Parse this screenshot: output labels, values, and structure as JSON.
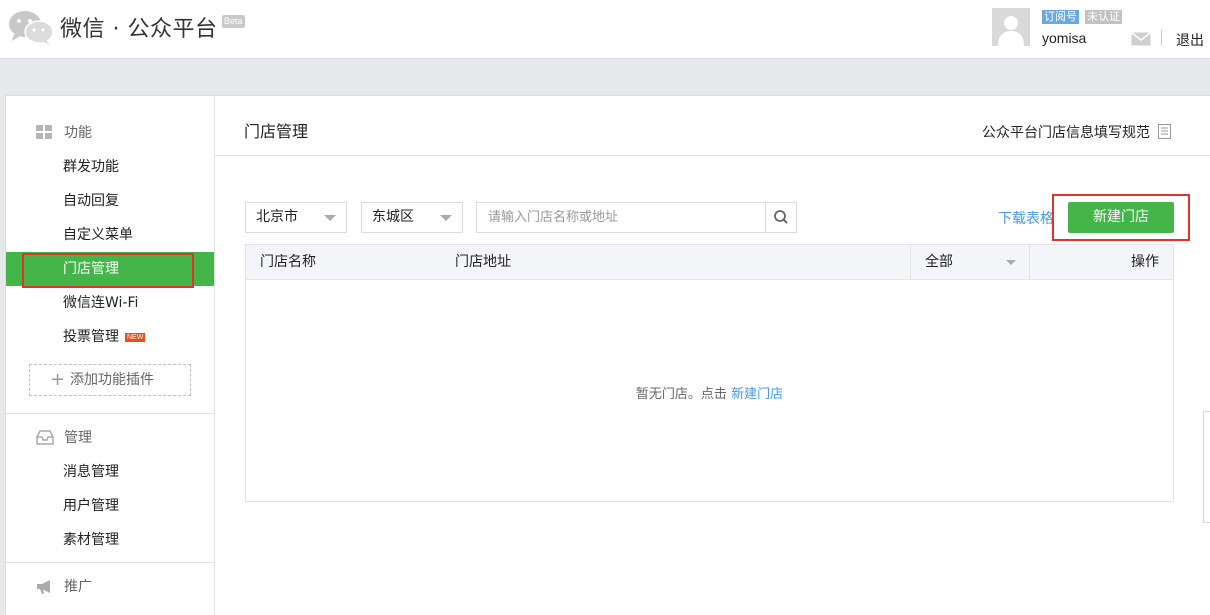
{
  "header": {
    "brand": "微信 · 公众平台",
    "beta": "Beta",
    "account_type": "订阅号",
    "verify_status": "未认证",
    "username": "yomisa",
    "logout": "退出"
  },
  "sidebar": {
    "sections": [
      {
        "title": "功能",
        "icon": "grid-icon",
        "items": [
          {
            "label": "群发功能"
          },
          {
            "label": "自动回复"
          },
          {
            "label": "自定义菜单"
          },
          {
            "label": "门店管理",
            "active": true
          },
          {
            "label": "微信连Wi-Fi"
          },
          {
            "label": "投票管理",
            "badge": "NEW"
          }
        ],
        "add_plugin": "添加功能插件"
      },
      {
        "title": "管理",
        "icon": "inbox-icon",
        "items": [
          {
            "label": "消息管理"
          },
          {
            "label": "用户管理"
          },
          {
            "label": "素材管理"
          }
        ]
      },
      {
        "title": "推广",
        "icon": "megaphone-icon",
        "items": []
      }
    ]
  },
  "main": {
    "title": "门店管理",
    "spec_link": "公众平台门店信息填写规范",
    "filters": {
      "city": "北京市",
      "district": "东城区",
      "search_placeholder": "请输入门店名称或地址"
    },
    "download_label": "下载表格",
    "new_store_button": "新建门店",
    "table": {
      "columns": [
        "门店名称",
        "门店地址",
        "全部",
        "操作"
      ],
      "empty_text": "暂无门店。点击",
      "empty_link": "新建门店"
    }
  },
  "colors": {
    "accent_green": "#44b549",
    "link_blue": "#459ae9",
    "highlight_red": "#e1322f"
  }
}
